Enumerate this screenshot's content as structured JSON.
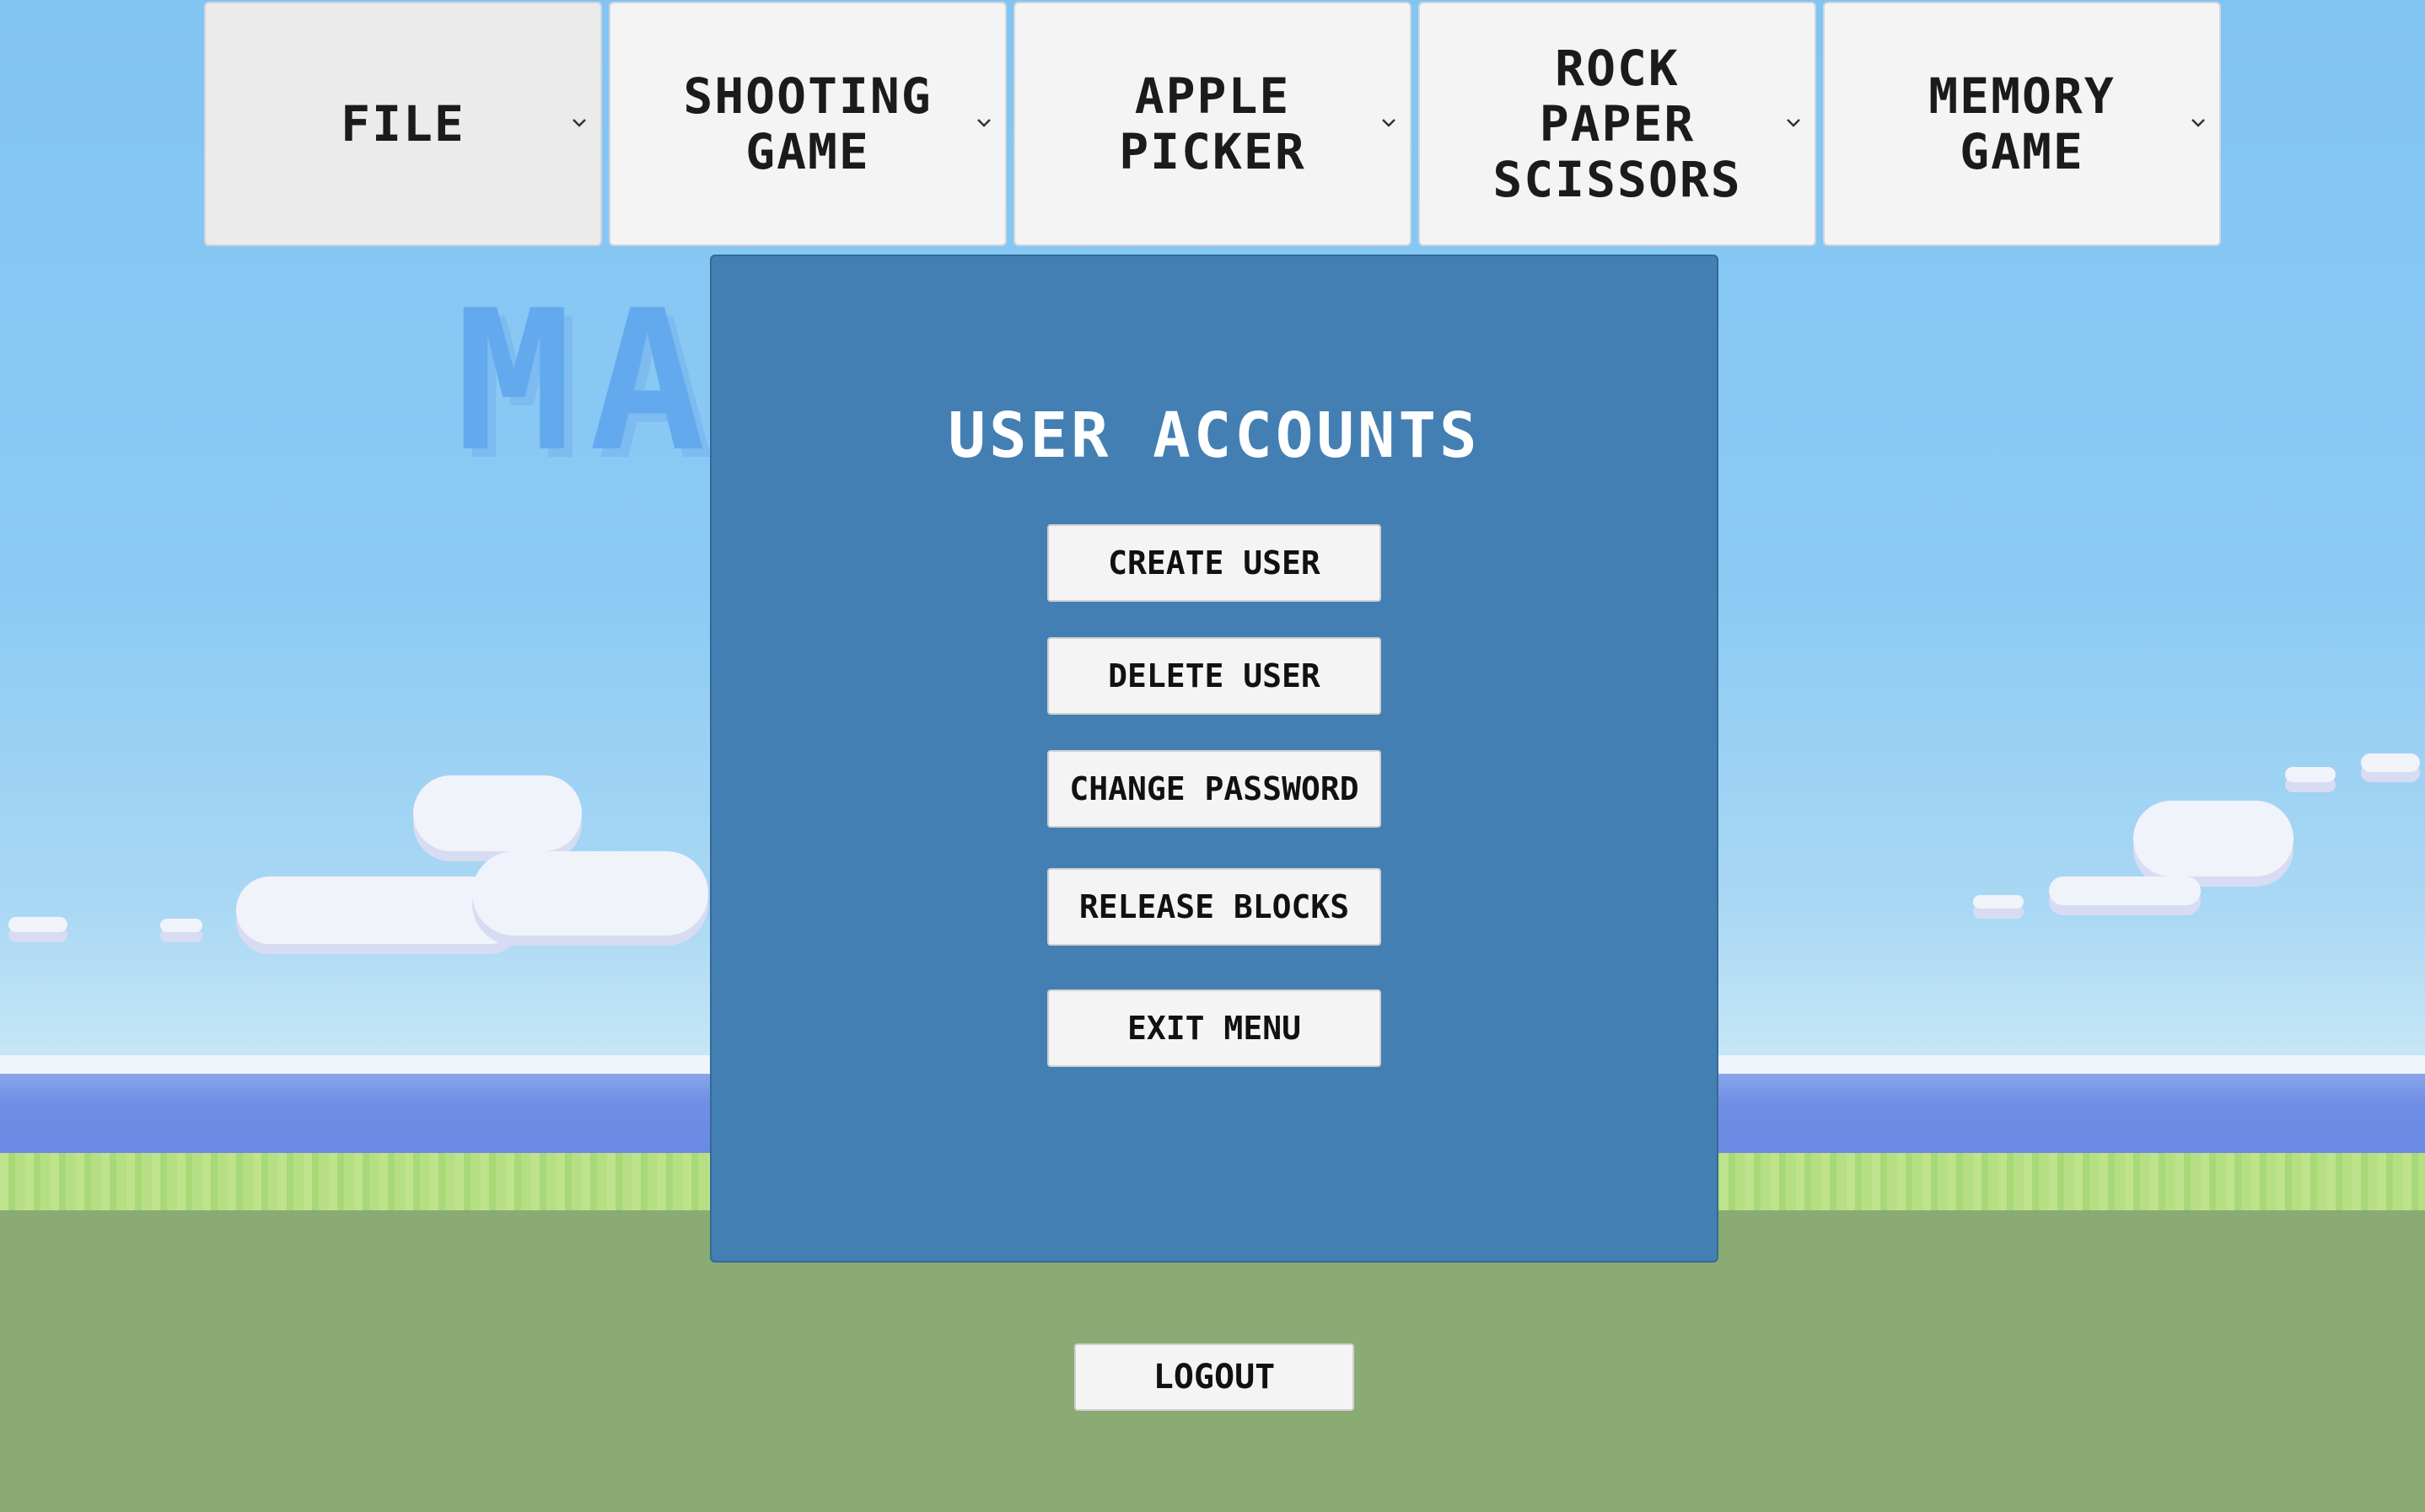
{
  "menubar": {
    "items": [
      {
        "label": "FILE",
        "icon": "chevron-down-icon"
      },
      {
        "label": "SHOOTING\nGAME",
        "icon": "chevron-down-icon"
      },
      {
        "label": "APPLE\nPICKER",
        "icon": "chevron-down-icon"
      },
      {
        "label": "ROCK PAPER\nSCISSORS",
        "icon": "chevron-down-icon"
      },
      {
        "label": "MEMORY\nGAME",
        "icon": "chevron-down-icon"
      }
    ]
  },
  "background": {
    "title": "MA ES"
  },
  "dialog": {
    "title": "USER ACCOUNTS",
    "buttons": [
      {
        "label": "CREATE USER"
      },
      {
        "label": "DELETE USER"
      },
      {
        "label": "CHANGE PASSWORD"
      },
      {
        "label": "RELEASE BLOCKS"
      },
      {
        "label": "EXIT MENU"
      }
    ]
  },
  "footer": {
    "logout_label": "LOGOUT"
  },
  "colors": {
    "panel": "#437fb3",
    "button_bg": "#f4f4f4",
    "sky": "#86c6f3",
    "ground": "#8aab73"
  }
}
